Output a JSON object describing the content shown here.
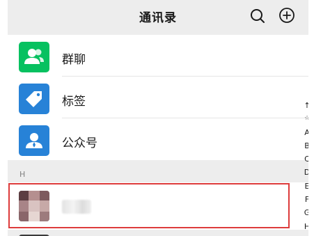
{
  "header": {
    "title": "通讯录",
    "search_icon": "search-icon",
    "add_icon": "plus-circle-icon"
  },
  "entries": [
    {
      "label": "群聊",
      "icon": "group-chat-icon",
      "color": "#07c160"
    },
    {
      "label": "标签",
      "icon": "tag-icon",
      "color": "#2782d7"
    },
    {
      "label": "公众号",
      "icon": "official-account-icon",
      "color": "#2782d7"
    }
  ],
  "section": {
    "letter": "H"
  },
  "contact": {
    "name": "",
    "avatar": "blurred-avatar"
  },
  "index": [
    "↑",
    "☆",
    "A",
    "B",
    "C",
    "D",
    "E",
    "F",
    "G",
    "H"
  ],
  "colors": {
    "highlight": "#dd3b3b",
    "background": "#ededed"
  }
}
